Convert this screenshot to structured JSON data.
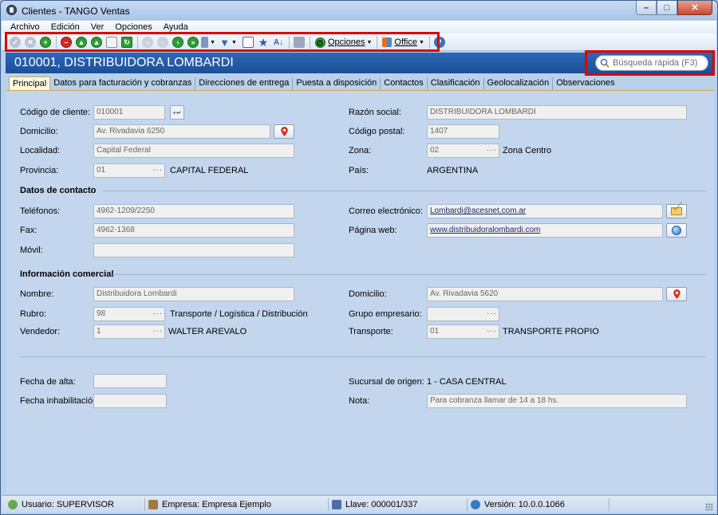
{
  "window": {
    "title": "Clientes - TANGO Ventas"
  },
  "menu": [
    "Archivo",
    "Edición",
    "Ver",
    "Opciones",
    "Ayuda"
  ],
  "toolbar": {
    "opciones_label": "Opciones",
    "office_label": "Office"
  },
  "header": {
    "title": "010001, DISTRIBUIDORA LOMBARDI",
    "search_placeholder": "Búsqueda rápida (F3)"
  },
  "tabs": [
    "Principal",
    "Datos para facturación y cobranzas",
    "Direcciones de entrega",
    "Puesta a disposición",
    "Contactos",
    "Clasificación",
    "Geolocalización",
    "Observaciones"
  ],
  "form": {
    "codigo_label": "Código de cliente:",
    "codigo_value": "010001",
    "razon_label": "Razón social:",
    "razon_value": "DISTRIBUIDORA LOMBARDI",
    "domicilio_label": "Domicilio:",
    "domicilio_value": "Av. Rivadavia 6250",
    "cp_label": "Código postal:",
    "cp_value": "1407",
    "localidad_label": "Localidad:",
    "localidad_value": "Capital Federal",
    "zona_label": "Zona:",
    "zona_code": "02",
    "zona_desc": "Zona Centro",
    "provincia_label": "Provincia:",
    "provincia_code": "01",
    "provincia_desc": "CAPITAL FEDERAL",
    "pais_label": "País:",
    "pais_value": "ARGENTINA",
    "contacto_section": "Datos de contacto",
    "telefonos_label": "Teléfonos:",
    "telefonos_value": "4962-1209/2250",
    "correo_label": "Correo electrónico:",
    "correo_value": "Lombardi@acesnet.com.ar",
    "fax_label": "Fax:",
    "fax_value": "4962-1368",
    "web_label": "Página web:",
    "web_value": "www.distribuidoralombardi.com",
    "movil_label": "Móvil:",
    "movil_value": "",
    "comercial_section": "Información comercial",
    "nombre_label": "Nombre:",
    "nombre_value": "Distribuidora Lombardi",
    "domicilio2_label": "Domicilio:",
    "domicilio2_value": "Av. Rivadavia 5620",
    "rubro_label": "Rubro:",
    "rubro_code": "98",
    "rubro_desc": "Transporte / Logística / Distribución",
    "grupo_label": "Grupo empresario:",
    "grupo_value": "",
    "vendedor_label": "Vendedor:",
    "vendedor_code": "1",
    "vendedor_desc": "WALTER AREVALO",
    "transporte_label": "Transporte:",
    "transporte_code": "01",
    "transporte_desc": "TRANSPORTE PROPIO",
    "alta_label": "Fecha de alta:",
    "alta_value": "",
    "sucursal_label": "Sucursal de origen:",
    "sucursal_value": "1 - CASA CENTRAL",
    "inhab_label": "Fecha inhabilitación:",
    "inhab_value": "",
    "nota_label": "Nota:",
    "nota_value": "Para cobranza llamar de 14 a 18 hs."
  },
  "status": {
    "usuario": "Usuario: SUPERVISOR",
    "empresa": "Empresa: Empresa Ejemplo",
    "llave": "Llave: 000001/337",
    "version": "Versión: 10.0.0.1066"
  },
  "colors": {
    "header_bg": "#1d4f96",
    "highlight_frame": "#e00000",
    "active_tab": "#fff9e1",
    "panel_bg": "#c3d6ed"
  }
}
